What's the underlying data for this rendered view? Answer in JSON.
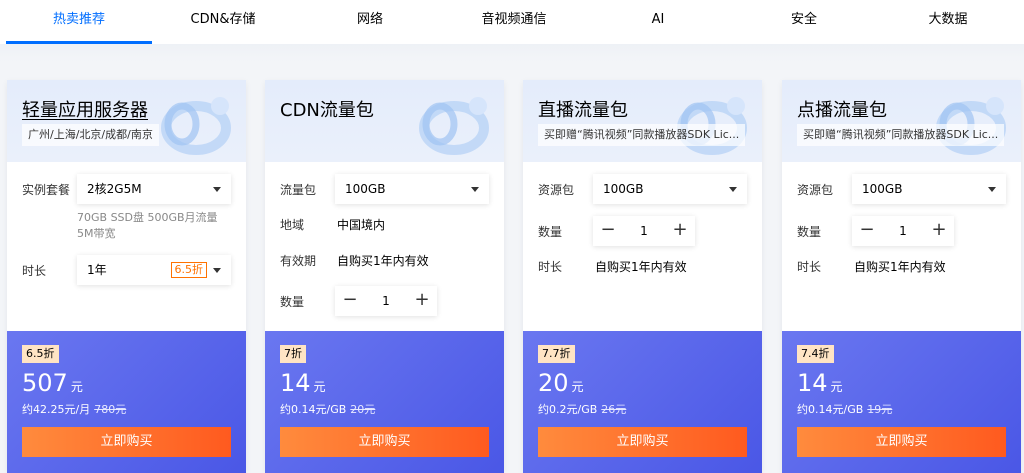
{
  "tabs": [
    "热卖推荐",
    "CDN&存储",
    "网络",
    "音视频通信",
    "AI",
    "安全",
    "大数据"
  ],
  "cards": [
    {
      "title": "轻量应用服务器",
      "subtitle": "广州/上海/北京/成都/南京",
      "fields": {
        "package_label": "实例套餐",
        "package_value": "2核2G5M",
        "package_hint": "70GB SSD盘 500GB月流量 5M带宽",
        "duration_label": "时长",
        "duration_value": "1年",
        "duration_discount": "6.5折"
      },
      "badge": "6.5折",
      "price": "507",
      "price_unit": "元",
      "sub_price": "约42.25元/月",
      "original_price": "780元",
      "buy_label": "立即购买"
    },
    {
      "title": "CDN流量包",
      "fields": {
        "package_label": "流量包",
        "package_value": "100GB",
        "region_label": "地域",
        "region_value": "中国境内",
        "validity_label": "有效期",
        "validity_value": "自购买1年内有效",
        "qty_label": "数量",
        "qty_value": "1"
      },
      "badge": "7折",
      "price": "14",
      "price_unit": "元",
      "sub_price": "约0.14元/GB",
      "original_price": "20元",
      "buy_label": "立即购买"
    },
    {
      "title": "直播流量包",
      "subtitle": "买即赠“腾讯视频”同款播放器SDK Lic...",
      "fields": {
        "package_label": "资源包",
        "package_value": "100GB",
        "qty_label": "数量",
        "qty_value": "1",
        "duration_label": "时长",
        "duration_value": "自购买1年内有效"
      },
      "badge": "7.7折",
      "price": "20",
      "price_unit": "元",
      "sub_price": "约0.2元/GB",
      "original_price": "26元",
      "buy_label": "立即购买"
    },
    {
      "title": "点播流量包",
      "subtitle": "买即赠“腾讯视频”同款播放器SDK Lic...",
      "fields": {
        "package_label": "资源包",
        "package_value": "100GB",
        "qty_label": "数量",
        "qty_value": "1",
        "duration_label": "时长",
        "duration_value": "自购买1年内有效"
      },
      "badge": "7.4折",
      "price": "14",
      "price_unit": "元",
      "sub_price": "约0.14元/GB",
      "original_price": "19元",
      "buy_label": "立即购买"
    }
  ],
  "colors": {
    "accent": "#006eff",
    "price_bg": "#5562ec",
    "buy_button": "#ff6a2a",
    "discount": "#ff7200"
  }
}
